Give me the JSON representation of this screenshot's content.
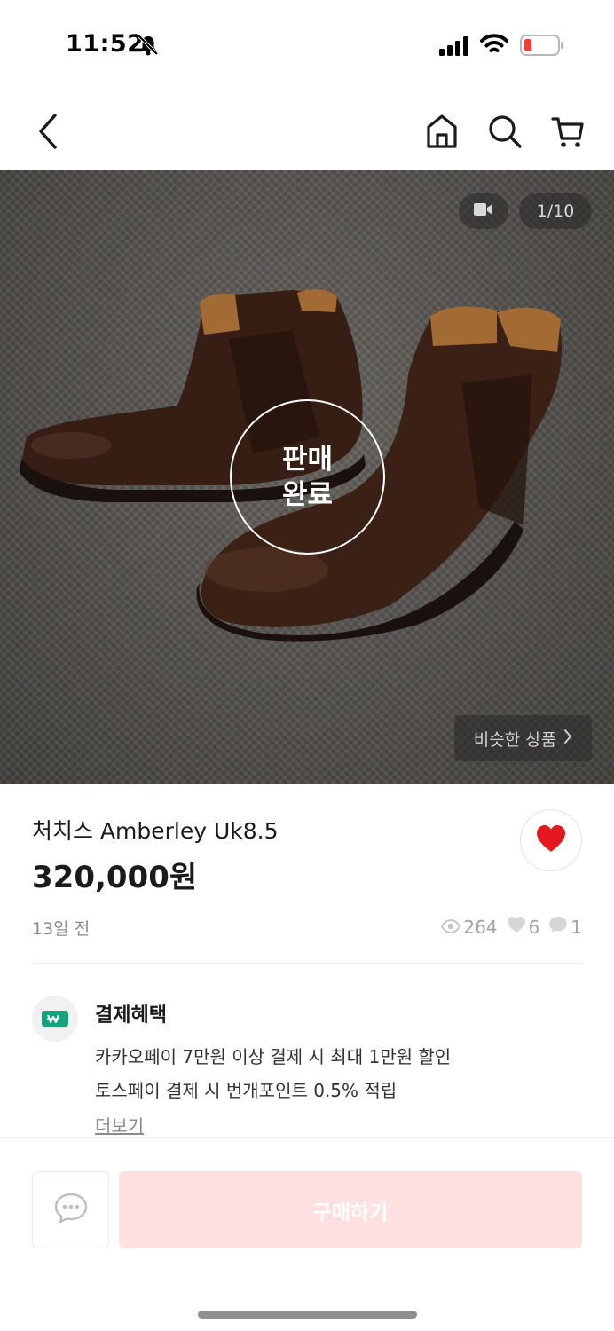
{
  "status_bar": {
    "time": "11:52"
  },
  "hero": {
    "page_indicator": "1/10",
    "sold_overlay": "판매 완료",
    "similar_button": "비슷한 상품"
  },
  "product": {
    "title": "처치스 Amberley Uk8.5",
    "price": "320,000원",
    "posted": "13일 전",
    "views": "264",
    "likes": "6",
    "chats": "1"
  },
  "benefits": {
    "title": "결제혜택",
    "lines": [
      "카카오페이 7만원 이상 결제 시 최대 1만원 할인",
      "토스페이 결제 시 번개포인트 0.5% 적립"
    ],
    "more": "더보기"
  },
  "bottom_bar": {
    "buy_label": "구매하기"
  },
  "colors": {
    "heart_red": "#e3171c",
    "buy_disabled_bg": "#fde0df",
    "pay_badge_green": "#14a37f",
    "leather_brown": "#4a2a1e"
  },
  "icons": [
    "bell-off-icon",
    "signal-icon",
    "wifi-icon",
    "battery-low-icon",
    "back-arrow-icon",
    "home-icon",
    "search-icon",
    "cart-icon",
    "video-icon",
    "chevron-right-icon",
    "heart-icon",
    "eye-icon",
    "chat-bubble-icon",
    "pay-badge-icon"
  ]
}
